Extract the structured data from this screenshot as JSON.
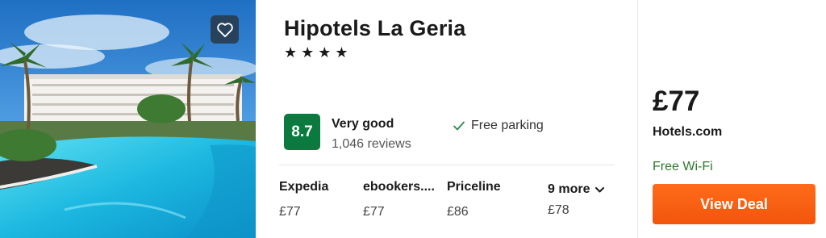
{
  "hotel": {
    "name": "Hipotels La Geria",
    "star_rating": 4,
    "star_glyph": "★",
    "photo": "resort-pool-photo",
    "favorite_icon": "heart-icon"
  },
  "rating": {
    "score": "8.7",
    "label": "Very good",
    "reviews": "1,046 reviews",
    "color": "#0a7a3e"
  },
  "amenities": [
    {
      "icon": "check-icon",
      "label": "Free parking"
    }
  ],
  "providers": [
    {
      "name": "Expedia",
      "price": "£77"
    },
    {
      "name": "ebookers....",
      "price": "£77"
    },
    {
      "name": "Priceline",
      "price": "£86"
    }
  ],
  "more": {
    "label": "9 more",
    "price": "£78",
    "icon": "chevron-down-icon"
  },
  "deal": {
    "price": "£77",
    "site": "Hotels.com",
    "perk": "Free Wi-Fi",
    "button_label": "View Deal",
    "button_color": "#f2550c"
  }
}
